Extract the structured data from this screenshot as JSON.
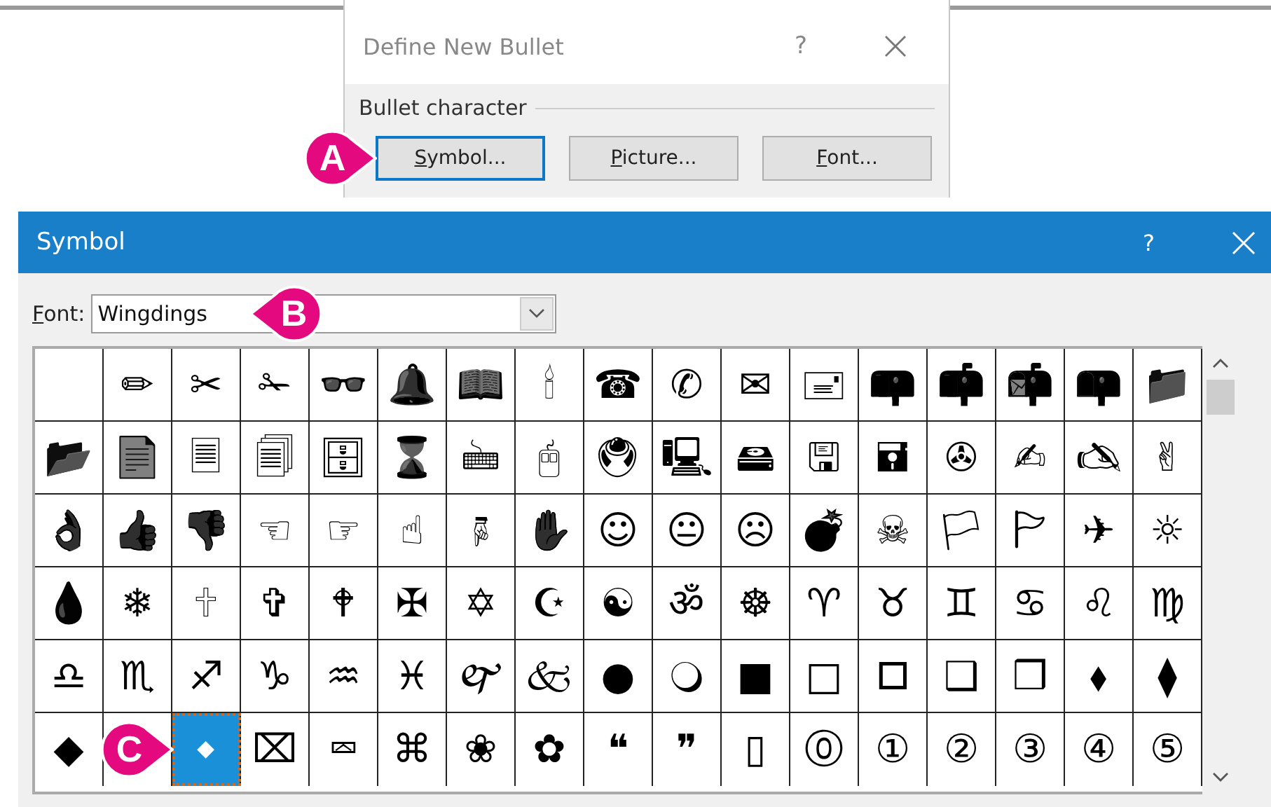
{
  "bullet_dialog": {
    "title": "Define New Bullet",
    "help": "?",
    "group_label": "Bullet character",
    "buttons": [
      {
        "key": "S",
        "rest": "ymbol...",
        "focused": true,
        "callout": "A"
      },
      {
        "key": "P",
        "rest": "icture...",
        "focused": false
      },
      {
        "key": "F",
        "rest": "ont...",
        "focused": false
      }
    ]
  },
  "symbol_window": {
    "title": "Symbol",
    "help": "?",
    "font": {
      "key": "F",
      "rest": "ont:",
      "value": "Wingdings",
      "callout": "B"
    },
    "rows": [
      [
        {
          "selected": false
        },
        {
          "glyph": "✏",
          "selected": false
        },
        {
          "glyph": "✂",
          "selected": false
        },
        {
          "glyph": "✁",
          "selected": false
        },
        {
          "glyph": "👓",
          "selected": false
        },
        {
          "glyph": "🔔",
          "selected": false
        },
        {
          "glyph": "📖",
          "selected": false
        },
        {
          "glyph": "🕯",
          "selected": false
        },
        {
          "glyph": "☎",
          "selected": false
        },
        {
          "glyph": "✆",
          "selected": false
        },
        {
          "glyph": "✉",
          "selected": false
        },
        {
          "glyph": "🖃",
          "selected": false
        },
        {
          "glyph": "📪",
          "selected": false
        },
        {
          "glyph": "📫",
          "selected": false
        },
        {
          "glyph": "📬",
          "selected": false
        },
        {
          "glyph": "📭",
          "selected": false
        },
        {
          "glyph": "📁",
          "selected": false
        }
      ],
      [
        {
          "glyph": "📂",
          "selected": false
        },
        {
          "glyph": "📄",
          "selected": false
        },
        {
          "glyph": "🗏",
          "selected": false
        },
        {
          "glyph": "🗐",
          "selected": false
        },
        {
          "glyph": "🗄",
          "selected": false
        },
        {
          "glyph": "⌛",
          "selected": false
        },
        {
          "glyph": "🖮",
          "selected": false
        },
        {
          "glyph": "🖰",
          "selected": false
        },
        {
          "glyph": "🖲",
          "selected": false
        },
        {
          "glyph": "🖳",
          "selected": false
        },
        {
          "glyph": "🖴",
          "selected": false
        },
        {
          "glyph": "🖫",
          "selected": false
        },
        {
          "glyph": "🖬",
          "selected": false
        },
        {
          "glyph": "✇",
          "selected": false
        },
        {
          "glyph": "✍",
          "selected": false
        },
        {
          "glyph": "🖎",
          "selected": false
        },
        {
          "glyph": "✌",
          "selected": false
        }
      ],
      [
        {
          "glyph": "👌",
          "selected": false
        },
        {
          "glyph": "👍",
          "selected": false
        },
        {
          "glyph": "👎",
          "selected": false
        },
        {
          "glyph": "☜",
          "selected": false
        },
        {
          "glyph": "☞",
          "selected": false
        },
        {
          "glyph": "☝",
          "selected": false
        },
        {
          "glyph": "🖗",
          "selected": false
        },
        {
          "glyph": "✋",
          "selected": false
        },
        {
          "glyph": "☺",
          "selected": false
        },
        {
          "glyph": "😐",
          "selected": false
        },
        {
          "glyph": "☹",
          "selected": false
        },
        {
          "glyph": "💣",
          "selected": false
        },
        {
          "glyph": "☠",
          "selected": false
        },
        {
          "glyph": "🏳",
          "selected": false
        },
        {
          "glyph": "🏱",
          "selected": false
        },
        {
          "glyph": "✈",
          "selected": false
        },
        {
          "glyph": "☼",
          "selected": false
        }
      ],
      [
        {
          "glyph": "💧",
          "selected": false
        },
        {
          "glyph": "❄",
          "selected": false
        },
        {
          "glyph": "🕆",
          "selected": false
        },
        {
          "glyph": "✞",
          "selected": false
        },
        {
          "glyph": "🕈",
          "selected": false
        },
        {
          "glyph": "✠",
          "selected": false
        },
        {
          "glyph": "✡",
          "selected": false
        },
        {
          "glyph": "☪",
          "selected": false
        },
        {
          "glyph": "☯",
          "selected": false
        },
        {
          "glyph": "ॐ",
          "selected": false
        },
        {
          "glyph": "☸",
          "selected": false
        },
        {
          "glyph": "♈",
          "selected": false
        },
        {
          "glyph": "♉",
          "selected": false
        },
        {
          "glyph": "♊",
          "selected": false
        },
        {
          "glyph": "♋",
          "selected": false
        },
        {
          "glyph": "♌",
          "selected": false
        },
        {
          "glyph": "♍",
          "selected": false
        }
      ],
      [
        {
          "glyph": "♎",
          "selected": false
        },
        {
          "glyph": "♏",
          "selected": false
        },
        {
          "glyph": "♐",
          "selected": false
        },
        {
          "glyph": "♑",
          "selected": false
        },
        {
          "glyph": "♒",
          "selected": false
        },
        {
          "glyph": "♓",
          "selected": false
        },
        {
          "glyph": "🙰",
          "selected": false
        },
        {
          "glyph": "🙵",
          "selected": false
        },
        {
          "glyph": "●",
          "selected": false
        },
        {
          "glyph": "🔾",
          "selected": false
        },
        {
          "glyph": "■",
          "selected": false
        },
        {
          "glyph": "□",
          "selected": false
        },
        {
          "glyph": "🞐",
          "selected": false
        },
        {
          "glyph": "❑",
          "selected": false
        },
        {
          "glyph": "❒",
          "selected": false
        },
        {
          "glyph": "⬧",
          "selected": false
        },
        {
          "glyph": "⧫",
          "selected": false
        }
      ],
      [
        {
          "glyph": "◆",
          "selected": false
        },
        {
          "selected": false,
          "callout": "C"
        },
        {
          "glyph": "⬥",
          "selected": true
        },
        {
          "glyph": "⌧",
          "selected": false
        },
        {
          "glyph": "⮹",
          "selected": false
        },
        {
          "glyph": "⌘",
          "selected": false
        },
        {
          "glyph": "❀",
          "selected": false
        },
        {
          "glyph": "✿",
          "selected": false
        },
        {
          "glyph": "❝",
          "selected": false
        },
        {
          "glyph": "❞",
          "selected": false
        },
        {
          "glyph": "▯",
          "selected": false
        },
        {
          "glyph": "⓪",
          "selected": false
        },
        {
          "glyph": "①",
          "selected": false
        },
        {
          "glyph": "②",
          "selected": false
        },
        {
          "glyph": "③",
          "selected": false
        },
        {
          "glyph": "④",
          "selected": false
        },
        {
          "glyph": "⑤",
          "selected": false
        }
      ]
    ]
  }
}
